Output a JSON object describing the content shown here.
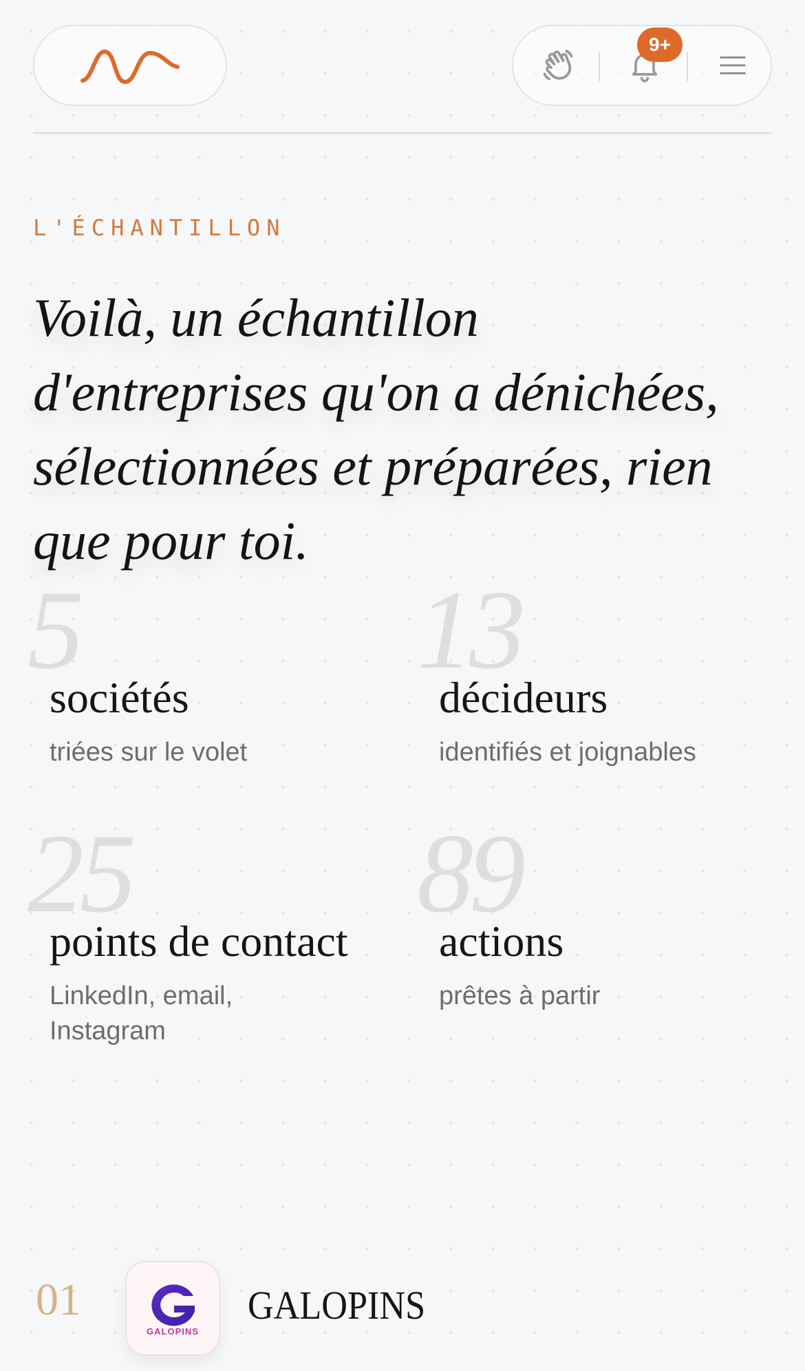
{
  "header": {
    "notifications_badge": "9+",
    "brand_color": "#de6a2a",
    "icons": [
      "waving-hand-icon",
      "bell-icon",
      "hamburger-menu-icon"
    ]
  },
  "intro": {
    "eyebrow": "L'ÉCHANTILLON",
    "headline": "Voilà, un échantillon d'entreprises qu'on a dénichées, sélectionnées et préparées, rien que pour toi."
  },
  "stats": [
    {
      "value": "5",
      "label": "sociétés",
      "description": "triées sur le volet"
    },
    {
      "value": "13",
      "label": "décideurs",
      "description": "identifiés et joignables"
    },
    {
      "value": "25",
      "label": "points de contact",
      "description": "LinkedIn, email, Instagram"
    },
    {
      "value": "89",
      "label": "actions",
      "description": "prêtes à partir"
    }
  ],
  "companies": [
    {
      "index": "01",
      "name": "GALOPINS",
      "logo_text": "GALOPINS",
      "logo_letter": "G"
    }
  ]
}
